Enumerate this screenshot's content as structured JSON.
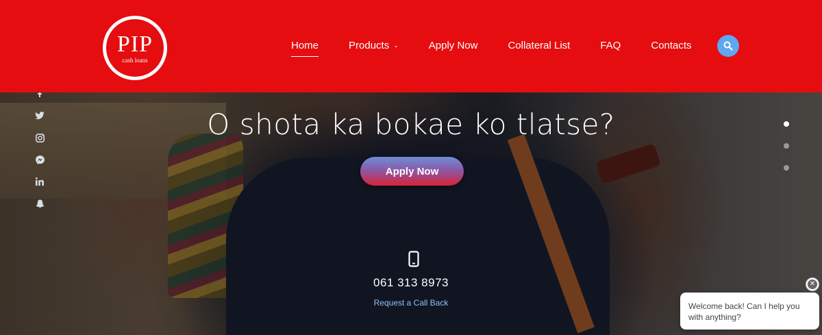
{
  "brand": {
    "logo_text": "PIP",
    "logo_sub": "cash loans"
  },
  "nav": {
    "items": [
      {
        "label": "Home",
        "active": true
      },
      {
        "label": "Products",
        "has_dropdown": true
      },
      {
        "label": "Apply Now"
      },
      {
        "label": "Collateral List"
      },
      {
        "label": "FAQ"
      },
      {
        "label": "Contacts"
      }
    ],
    "search_icon": "search-icon"
  },
  "social": [
    "facebook-icon",
    "twitter-icon",
    "instagram-icon",
    "messenger-icon",
    "linkedin-icon",
    "snapchat-icon"
  ],
  "hero": {
    "headline": "O shota ka bokae ko tlatse?",
    "cta_label": "Apply Now",
    "phone_number": "061 313 8973",
    "callback_label": "Request a Call Back"
  },
  "slider": {
    "count": 3,
    "active": 0
  },
  "chat": {
    "message": "Welcome back! Can I help you with anything?"
  },
  "colors": {
    "header": "#e50d0f",
    "search": "#5ea7f1",
    "link": "#8fc1ef"
  }
}
